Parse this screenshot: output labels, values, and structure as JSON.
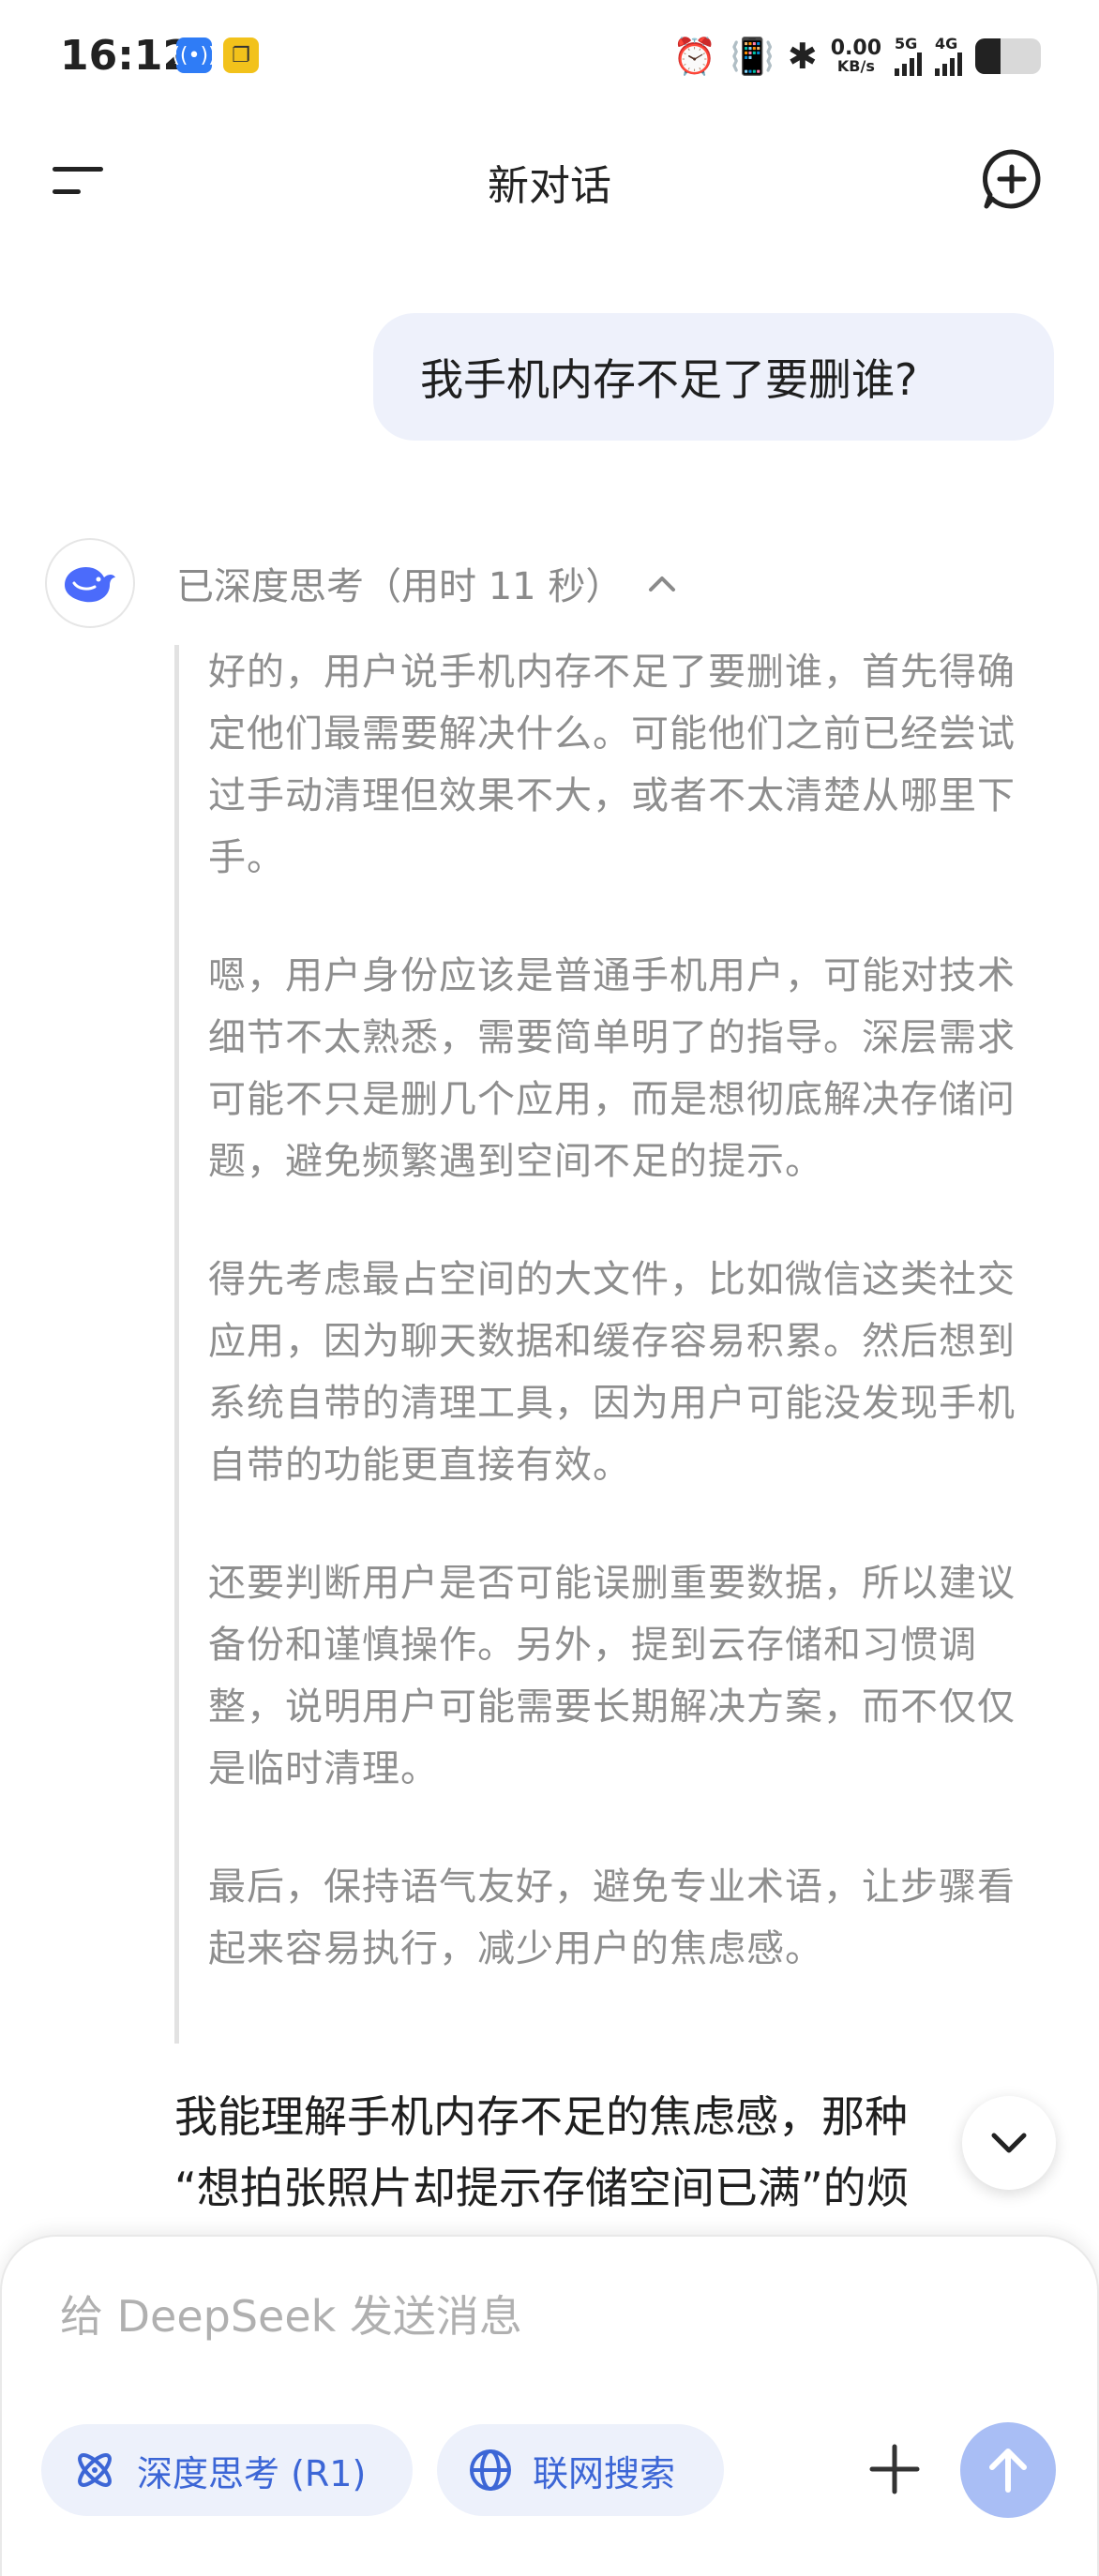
{
  "status_bar": {
    "time": "16:12",
    "net_speed_value": "0.00",
    "net_speed_unit": "KB/s",
    "sim1_label": "5G",
    "sim2_label": "4G",
    "battery_level": 0.38
  },
  "header": {
    "title": "新对话"
  },
  "conversation": {
    "user_message": "我手机内存不足了要删谁?",
    "think_header": "已深度思考（用时 11 秒）",
    "think_paragraphs": [
      "好的，用户说手机内存不足了要删谁，首先得确定他们最需要解决什么。可能他们之前已经尝试过手动清理但效果不大，或者不太清楚从哪里下手。",
      "嗯，用户身份应该是普通手机用户，可能对技术细节不太熟悉，需要简单明了的指导。深层需求可能不只是删几个应用，而是想彻底解决存储问题，避免频繁遇到空间不足的提示。",
      "得先考虑最占空间的大文件，比如微信这类社交应用，因为聊天数据和缓存容易积累。然后想到系统自带的清理工具，因为用户可能没发现手机自带的功能更直接有效。",
      "还要判断用户是否可能误删重要数据，所以建议备份和谨慎操作。另外，提到云存储和习惯调整，说明用户可能需要长期解决方案，而不仅仅是临时清理。",
      "最后，保持语气友好，避免专业术语，让步骤看起来容易执行，减少用户的焦虑感。"
    ],
    "answer_line1": "我能理解手机内存不足的焦虑感，那种",
    "answer_line2": "“想拍张照片却提示存储空间已满”的烦"
  },
  "composer": {
    "placeholder": "给 DeepSeek 发送消息",
    "deep_think_label": "深度思考 (R1)",
    "web_search_label": "联网搜索"
  },
  "colors": {
    "accent": "#3c66d6",
    "pill_bg": "#edf1fb",
    "send_bg": "#a9bef5",
    "user_bubble_bg": "#eef1fb"
  }
}
